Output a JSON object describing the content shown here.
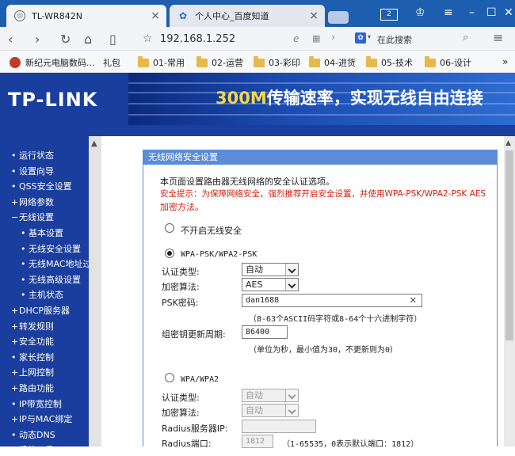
{
  "browser": {
    "tabs": [
      {
        "title": "TL-WR842N",
        "active": true
      },
      {
        "title": "个人中心_百度知道",
        "active": false
      }
    ],
    "tab_count": "2",
    "address": "192.168.1.252",
    "search_placeholder": "在此搜索",
    "bookmarks": [
      {
        "label": "新纪元电脑数码...",
        "type": "site"
      },
      {
        "label": "礼包",
        "type": "link"
      },
      {
        "label": "01-常用",
        "type": "folder"
      },
      {
        "label": "02-运营",
        "type": "folder"
      },
      {
        "label": "03-彩印",
        "type": "folder"
      },
      {
        "label": "04-进货",
        "type": "folder"
      },
      {
        "label": "05-技术",
        "type": "folder"
      },
      {
        "label": "06-设计",
        "type": "folder"
      }
    ],
    "more_label": "»"
  },
  "header": {
    "logo": "TP-LINK",
    "banner_highlight": "300M",
    "banner_text": "传输速率，实现无线自由连接",
    "colors": {
      "brand_blue": "#1a3e9e",
      "banner_yellow": "#f5d64a"
    }
  },
  "sidebar": {
    "items": [
      {
        "label": "运行状态",
        "bullet": "•",
        "sub": false
      },
      {
        "label": "设置向导",
        "bullet": "•",
        "sub": false
      },
      {
        "label": "QSS安全设置",
        "bullet": "•",
        "sub": false
      },
      {
        "label": "网络参数",
        "bullet": "+",
        "sub": false
      },
      {
        "label": "无线设置",
        "bullet": "−",
        "sub": false
      },
      {
        "label": "基本设置",
        "bullet": "•",
        "sub": true
      },
      {
        "label": "无线安全设置",
        "bullet": "•",
        "sub": true
      },
      {
        "label": "无线MAC地址过滤",
        "bullet": "•",
        "sub": true
      },
      {
        "label": "无线高级设置",
        "bullet": "•",
        "sub": true
      },
      {
        "label": "主机状态",
        "bullet": "•",
        "sub": true
      },
      {
        "label": "DHCP服务器",
        "bullet": "+",
        "sub": false
      },
      {
        "label": "转发规则",
        "bullet": "+",
        "sub": false
      },
      {
        "label": "安全功能",
        "bullet": "+",
        "sub": false
      },
      {
        "label": "家长控制",
        "bullet": "•",
        "sub": false
      },
      {
        "label": "上网控制",
        "bullet": "+",
        "sub": false
      },
      {
        "label": "路由功能",
        "bullet": "+",
        "sub": false
      },
      {
        "label": "IP带宽控制",
        "bullet": "•",
        "sub": false
      },
      {
        "label": "IP与MAC绑定",
        "bullet": "+",
        "sub": false
      },
      {
        "label": "动态DNS",
        "bullet": "•",
        "sub": false
      },
      {
        "label": "系统工具",
        "bullet": "+",
        "sub": false
      }
    ]
  },
  "panel": {
    "title": "无线网络安全设置",
    "intro": "本页面设置路由器无线网络的安全认证选项。",
    "warning_line1": "安全提示：为保障网络安全，强烈推荐开启安全设置，并使用WPA-PSK/WPA2-PSK AES",
    "warning_line2": "加密方法。",
    "option_none": "不开启无线安全",
    "option_psk": "WPA-PSK/WPA2-PSK",
    "option_wpa": "WPA/WPA2",
    "psk": {
      "auth_label": "认证类型:",
      "auth_value": "自动",
      "enc_label": "加密算法:",
      "enc_value": "AES",
      "key_label": "PSK密码:",
      "key_value": "dan1688",
      "key_hint": "（8-63个ASCII码字符或8-64个十六进制字符）",
      "rekey_label": "组密钥更新周期:",
      "rekey_value": "86400",
      "rekey_hint": "（单位为秒，最小值为30，不更新则为0）"
    },
    "wpa": {
      "auth_label": "认证类型:",
      "auth_value": "自动",
      "enc_label": "加密算法:",
      "enc_value": "自动",
      "radius_ip_label": "Radius服务器IP:",
      "radius_ip_value": "",
      "radius_port_label": "Radius端口:",
      "radius_port_value": "1812",
      "radius_port_hint": "（1-65535，0表示默认端口：1812）"
    }
  }
}
